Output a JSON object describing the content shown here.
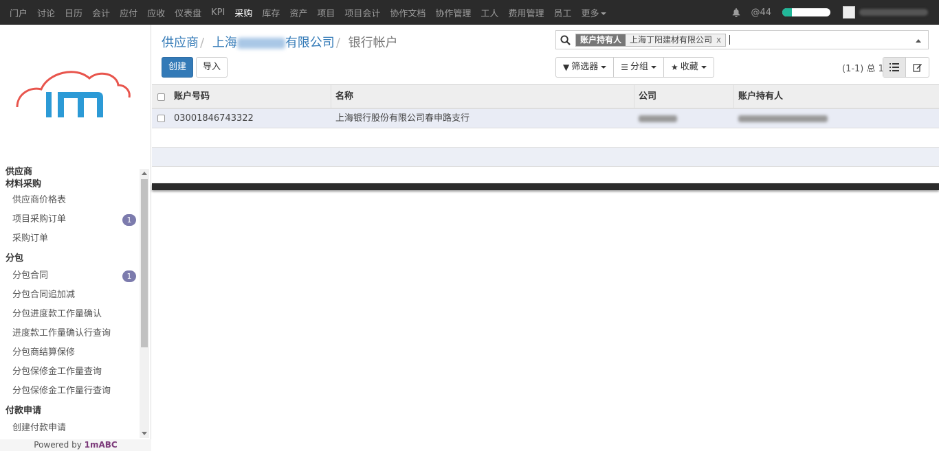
{
  "topmenu": [
    {
      "label": "门户",
      "active": false
    },
    {
      "label": "讨论",
      "active": false
    },
    {
      "label": "日历",
      "active": false
    },
    {
      "label": "会计",
      "active": false
    },
    {
      "label": "应付",
      "active": false
    },
    {
      "label": "应收",
      "active": false
    },
    {
      "label": "仪表盘",
      "active": false
    },
    {
      "label": "KPI",
      "active": false
    },
    {
      "label": "采购",
      "active": true
    },
    {
      "label": "库存",
      "active": false
    },
    {
      "label": "资产",
      "active": false
    },
    {
      "label": "项目",
      "active": false
    },
    {
      "label": "项目会计",
      "active": false
    },
    {
      "label": "协作文档",
      "active": false
    },
    {
      "label": "协作管理",
      "active": false
    },
    {
      "label": "工人",
      "active": false
    },
    {
      "label": "费用管理",
      "active": false
    },
    {
      "label": "员工",
      "active": false
    },
    {
      "label": "更多",
      "active": false
    }
  ],
  "topright": {
    "mentions": "@44",
    "progress": 0.2
  },
  "sidebar": {
    "groups": [
      {
        "title": "供应商",
        "items": []
      },
      {
        "title": "材料采购",
        "items": [
          {
            "label": "供应商价格表",
            "badge": ""
          },
          {
            "label": "项目采购订单",
            "badge": "1"
          },
          {
            "label": "采购订单",
            "badge": ""
          }
        ]
      },
      {
        "title": "分包",
        "items": [
          {
            "label": "分包合同",
            "badge": "1"
          },
          {
            "label": "分包合同追加减",
            "badge": ""
          },
          {
            "label": "分包进度款工作量确认",
            "badge": ""
          },
          {
            "label": "进度款工作量确认行查询",
            "badge": ""
          },
          {
            "label": "分包商结算保修",
            "badge": ""
          },
          {
            "label": "分包保修金工作量查询",
            "badge": ""
          },
          {
            "label": "分包保修金工作量行查询",
            "badge": ""
          }
        ]
      },
      {
        "title": "付款申请",
        "items": [
          {
            "label": "创建付款申请",
            "badge": ""
          }
        ]
      }
    ],
    "powered_prefix": "Powered by ",
    "powered_brand": "1mABC"
  },
  "breadcrumb": {
    "crumb1": "供应商",
    "crumb2_prefix": "上海",
    "crumb2_suffix": "有限公司",
    "current": "银行帐户"
  },
  "buttons": {
    "create": "创建",
    "import": "导入"
  },
  "search": {
    "facet_title": "账户持有人",
    "facet_value": "上海丁阳建材有限公司",
    "facet_close": "x"
  },
  "filters": {
    "filter": "筛选器",
    "group": "分组",
    "favorites": "收藏"
  },
  "pager": "(1-1) 总 1",
  "table": {
    "columns": [
      "账户号码",
      "名称",
      "公司",
      "账户持有人"
    ],
    "rows": [
      {
        "account": "03001846743322",
        "name": "上海银行股份有限公司春申路支行"
      }
    ]
  }
}
